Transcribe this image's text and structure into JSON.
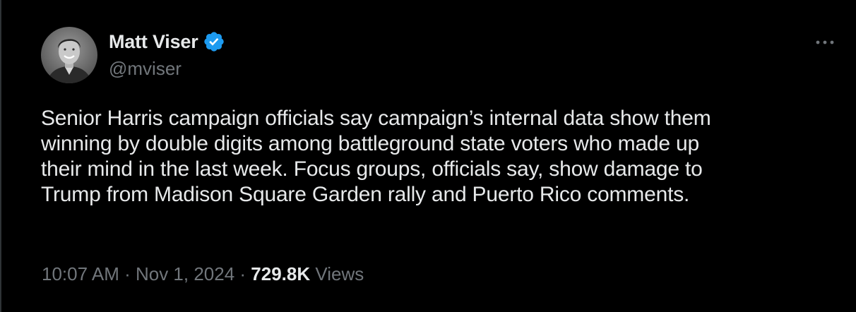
{
  "author": {
    "display_name": "Matt Viser",
    "handle": "@mviser",
    "verified_color": "#1d9bf0"
  },
  "tweet": {
    "lines": [
      "Senior Harris campaign officials say campaign’s internal data show them",
      "winning by double digits among battleground state voters who made up",
      "their mind in the last week. Focus groups, officials say, show damage to",
      "Trump from Madison Square Garden rally and Puerto Rico comments."
    ]
  },
  "meta": {
    "time": "10:07 AM",
    "separator": " · ",
    "date": "Nov 1, 2024",
    "views_count": "729.8K",
    "views_label": "Views"
  },
  "icons": {
    "avatar": "avatar-photo",
    "verified": "verified-badge-icon",
    "more": "more-options-icon"
  },
  "colors": {
    "background": "#000000",
    "text_primary": "#e7e9ea",
    "text_secondary": "#71767b"
  }
}
